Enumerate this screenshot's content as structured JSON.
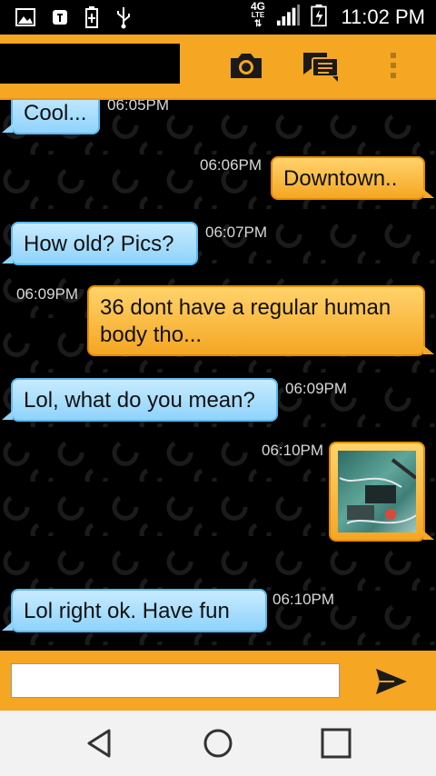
{
  "status_bar": {
    "time": "11:02 PM",
    "network": "4G",
    "network_sub": "LTE",
    "icons": [
      "image-icon",
      "app-notification-icon",
      "battery-saver-icon",
      "usb-icon",
      "signal-icon",
      "battery-charging-icon"
    ]
  },
  "app_bar": {
    "contact_name": "",
    "actions": [
      "camera-icon",
      "chat-list-icon",
      "overflow-menu-icon"
    ]
  },
  "messages": [
    {
      "direction": "in",
      "text": "Cool...",
      "time": "06:05PM"
    },
    {
      "direction": "out",
      "text": "Downtown..",
      "time": "06:06PM"
    },
    {
      "direction": "in",
      "text": "How old?  Pics?",
      "time": "06:07PM"
    },
    {
      "direction": "out",
      "text": "36 dont have a regular human body tho...",
      "time": "06:09PM"
    },
    {
      "direction": "in",
      "text": "Lol, what do you mean?",
      "time": "06:09PM"
    },
    {
      "direction": "out",
      "type": "image",
      "time": "06:10PM"
    },
    {
      "direction": "in",
      "text": "Lol right ok.  Have fun",
      "time": "06:10PM"
    }
  ],
  "composer": {
    "value": "",
    "placeholder": "",
    "send_icon": "send-icon"
  },
  "colors": {
    "accent": "#f5a623",
    "incoming_bubble": "#8fd3fb",
    "outgoing_bubble": "#f5a623"
  },
  "nav_bar": [
    "back-icon",
    "home-icon",
    "recents-icon"
  ]
}
